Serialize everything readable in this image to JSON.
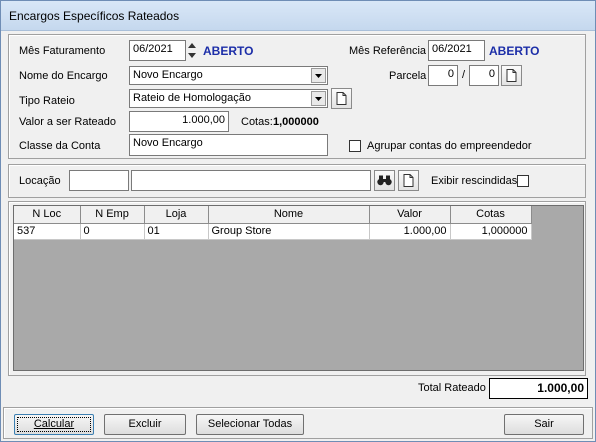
{
  "window": {
    "title": "Encargos Específicos Rateados"
  },
  "form": {
    "mes_faturamento": {
      "label": "Mês Faturamento",
      "value": "06/2021",
      "status": "ABERTO"
    },
    "mes_referencia": {
      "label": "Mês Referência",
      "value": "06/2021",
      "status": "ABERTO"
    },
    "nome_encargo": {
      "label": "Nome do Encargo",
      "value": "Novo Encargo"
    },
    "parcela": {
      "label": "Parcela",
      "value1": "0",
      "sep": "/",
      "value2": "0"
    },
    "tipo_rateio": {
      "label": "Tipo Rateio",
      "value": "Rateio de Homologação"
    },
    "valor_rateado": {
      "label": "Valor a ser Rateado",
      "value": "1.000,00"
    },
    "cotas": {
      "label": "Cotas:",
      "value": "1,000000"
    },
    "classe_conta": {
      "label": "Classe da Conta",
      "value": "Novo Encargo"
    },
    "agrupar": {
      "label": "Agrupar contas do empreendedor",
      "checked": false
    }
  },
  "filter": {
    "locacao_label": "Locação",
    "locacao_code": "",
    "locacao_name": "",
    "exibir_label": "Exibir rescindidas"
  },
  "grid": {
    "columns": [
      "N Loc",
      "N Emp",
      "Loja",
      "Nome",
      "Valor",
      "Cotas"
    ],
    "rows": [
      [
        "537",
        "0",
        "01",
        "Group Store",
        "1.000,00",
        "1,000000"
      ]
    ]
  },
  "total": {
    "label": "Total Rateado",
    "value": "1.000,00"
  },
  "buttons": {
    "calcular": "Calcular",
    "excluir": "Excluir",
    "selecionar": "Selecionar Todas",
    "sair": "Sair"
  }
}
